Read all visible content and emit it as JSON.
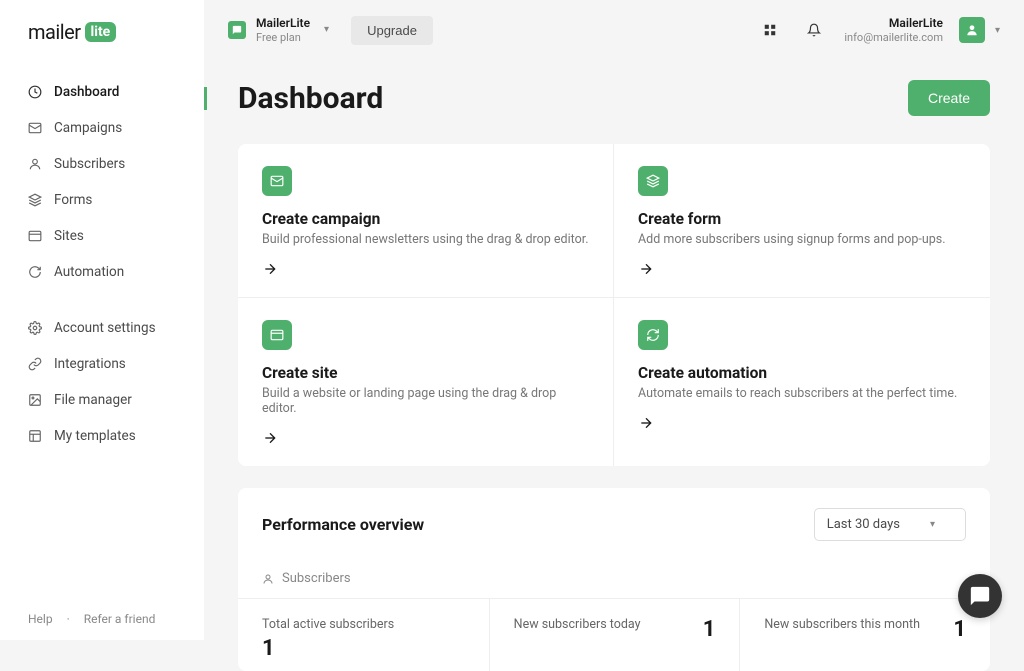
{
  "logo": {
    "prefix": "mailer",
    "badge": "lite"
  },
  "nav": {
    "dashboard": "Dashboard",
    "campaigns": "Campaigns",
    "subscribers": "Subscribers",
    "forms": "Forms",
    "sites": "Sites",
    "automation": "Automation",
    "account_settings": "Account settings",
    "integrations": "Integrations",
    "file_manager": "File manager",
    "my_templates": "My templates"
  },
  "sidebar_footer": {
    "help": "Help",
    "sep": "·",
    "refer": "Refer a friend"
  },
  "header": {
    "account_name": "MailerLite",
    "account_plan": "Free plan",
    "upgrade": "Upgrade",
    "user_name": "MailerLite",
    "user_email": "info@mailerlite.com"
  },
  "page": {
    "title": "Dashboard",
    "create": "Create"
  },
  "cards": {
    "campaign": {
      "title": "Create campaign",
      "desc": "Build professional newsletters using the drag & drop editor."
    },
    "form": {
      "title": "Create form",
      "desc": "Add more subscribers using signup forms and pop-ups."
    },
    "site": {
      "title": "Create site",
      "desc": "Build a website or landing page using the drag & drop editor."
    },
    "automation": {
      "title": "Create automation",
      "desc": "Automate emails to reach subscribers at the perfect time."
    }
  },
  "perf": {
    "title": "Performance overview",
    "range": "Last 30 days",
    "tab": "Subscribers",
    "stats": {
      "active": {
        "label": "Total active subscribers",
        "value": "1"
      },
      "today": {
        "label": "New subscribers today",
        "value": "1"
      },
      "month": {
        "label": "New subscribers this month",
        "value": "1"
      }
    }
  }
}
